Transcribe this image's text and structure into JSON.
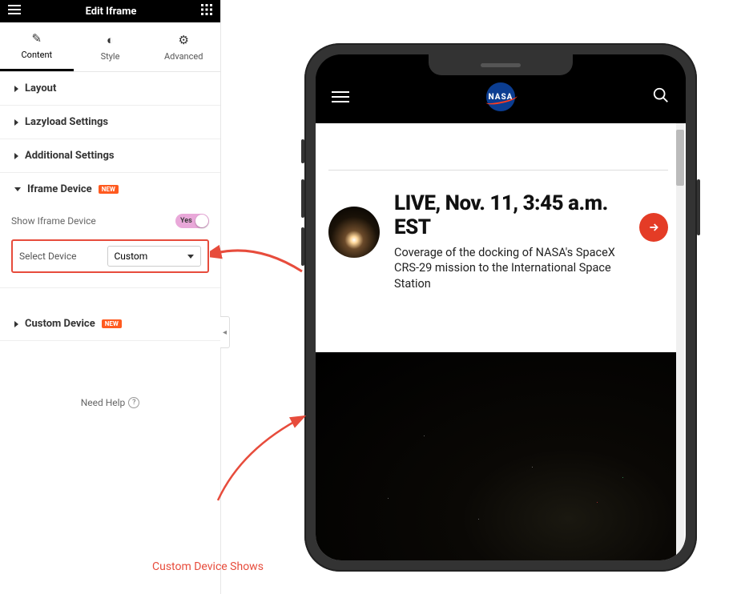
{
  "panel": {
    "title": "Edit Iframe",
    "tabs": {
      "content": "Content",
      "style": "Style",
      "advanced": "Advanced"
    },
    "sections": {
      "layout": "Layout",
      "lazyload": "Lazyload Settings",
      "additional": "Additional Settings",
      "iframeDevice": "Iframe Device",
      "customDevice": "Custom Device"
    },
    "badge_new": "NEW",
    "controls": {
      "showDevice_label": "Show Iframe Device",
      "toggle_value": "Yes",
      "selectDevice_label": "Select Device",
      "selectDevice_value": "Custom"
    },
    "help": "Need Help"
  },
  "annotations": {
    "customDeviceShows": "Custom Device Shows"
  },
  "preview": {
    "logo_text": "NASA",
    "news_title": "LIVE, Nov. 11, 3:45 a.m. EST",
    "news_desc": "Coverage of the docking of NASA's SpaceX CRS-29 mission to the International Space Station"
  }
}
